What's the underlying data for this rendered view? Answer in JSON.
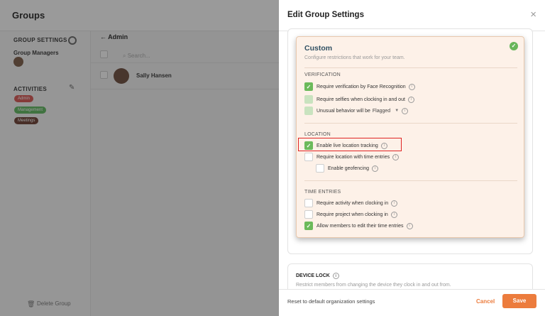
{
  "background": {
    "title": "Groups",
    "sidebar": {
      "group_settings": "GROUP SETTINGS",
      "group_managers": "Group Managers",
      "activities": "ACTIVITIES",
      "pills": [
        {
          "label": "Admin",
          "color": "#d9534f"
        },
        {
          "label": "Management",
          "color": "#5cb85c"
        },
        {
          "label": "Meetings",
          "color": "#6b3b2e"
        }
      ],
      "delete_group": "Delete Group"
    },
    "main": {
      "back_title": "Admin",
      "search_placeholder": "Search...",
      "member_name": "Sally Hansen"
    }
  },
  "drawer": {
    "title": "Edit Group Settings",
    "close_icon": "×",
    "custom": {
      "title": "Custom",
      "subtitle": "Configure restrictions that work for your team.",
      "verification": {
        "heading": "VERIFICATION",
        "options": [
          {
            "label": "Require verification by Face Recognition",
            "state": "checked"
          },
          {
            "label": "Require selfies when clocking in and out",
            "state": "checked-disabled"
          },
          {
            "label": "Unusual behavior will be",
            "state": "checked-disabled",
            "select_value": "Flagged"
          }
        ]
      },
      "location": {
        "heading": "LOCATION",
        "options": [
          {
            "label": "Enable live location tracking",
            "state": "checked"
          },
          {
            "label": "Require location with time entries",
            "state": "unchecked"
          },
          {
            "label": "Enable geofencing",
            "state": "unchecked"
          }
        ]
      },
      "time_entries": {
        "heading": "TIME ENTRIES",
        "options": [
          {
            "label": "Require activity when clocking in",
            "state": "unchecked"
          },
          {
            "label": "Require project when clocking in",
            "state": "unchecked"
          },
          {
            "label": "Allow members to edit their time entries",
            "state": "checked"
          }
        ]
      }
    },
    "device_lock": {
      "title": "DEVICE LOCK",
      "subtitle": "Restrict members from changing the device they clock in and out from."
    },
    "footer": {
      "reset_label": "Reset to default organization settings",
      "cancel_label": "Cancel",
      "save_label": "Save"
    },
    "accent_color": "#ec7c3d",
    "check_color": "#6bba5b"
  }
}
